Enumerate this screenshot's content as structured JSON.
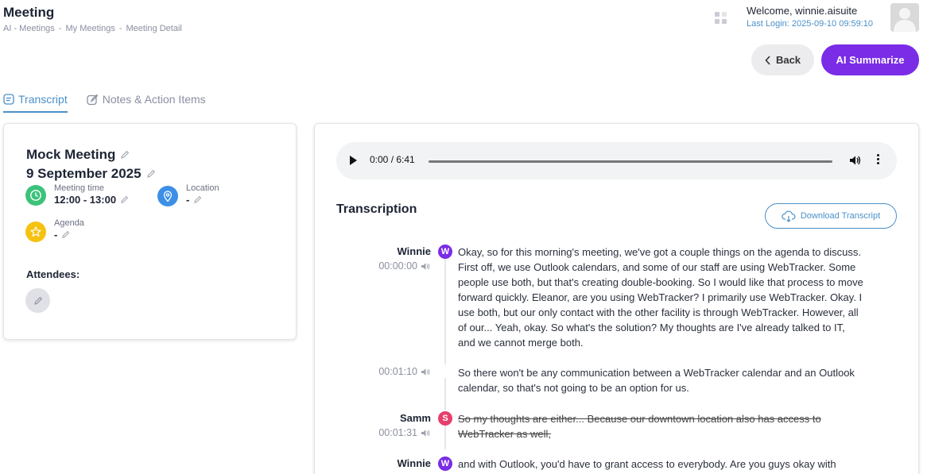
{
  "header": {
    "title": "Meeting",
    "breadcrumb": [
      "AI - Meetings",
      "My Meetings",
      "Meeting Detail"
    ],
    "breadcrumb_sep": "-",
    "welcome": "Welcome, winnie.aisuite",
    "last_login": "Last Login: 2025-09-10 09:59:10"
  },
  "actions": {
    "back_label": "Back",
    "ai_summarize_label": "AI Summarize"
  },
  "tabs": [
    {
      "label": "Transcript",
      "active": true
    },
    {
      "label": "Notes & Action Items",
      "active": false
    }
  ],
  "meeting": {
    "name": "Mock Meeting",
    "date": "9 September 2025",
    "time_label": "Meeting time",
    "time_value": "12:00 - 13:00",
    "location_label": "Location",
    "location_value": "-",
    "agenda_label": "Agenda",
    "agenda_value": "-",
    "attendees_label": "Attendees:"
  },
  "audio": {
    "time": "0:00 / 6:41"
  },
  "transcription": {
    "title": "Transcription",
    "download_label": "Download Transcript",
    "entries": [
      {
        "speaker": "Winnie",
        "initial": "W",
        "color": "#7a2ce6",
        "timestamp": "00:00:00",
        "struck": false,
        "text": "Okay, so for this morning's meeting, we've got a couple things on the agenda to discuss. First off, we use Outlook calendars, and some of our staff are using WebTracker. Some people use both, but that's creating double-booking. So I would like that process to move forward quickly. Eleanor, are you using WebTracker? I primarily use WebTracker. Okay. I use both, but our only contact with the other facility is through WebTracker. However, all of our... Yeah, okay. So what's the solution? My thoughts are I've already talked to IT, and we cannot merge both."
      },
      {
        "speaker": "",
        "initial": "",
        "color": "",
        "timestamp": "00:01:10",
        "struck": false,
        "text": "So there won't be any communication between a WebTracker calendar and an Outlook calendar, so that's not going to be an option for us."
      },
      {
        "speaker": "Samm",
        "initial": "S",
        "color": "#e83e6c",
        "timestamp": "00:01:31",
        "struck": true,
        "text": "So my thoughts are either... Because our downtown location also has access to WebTracker as well,"
      },
      {
        "speaker": "Winnie",
        "initial": "W",
        "color": "#7a2ce6",
        "timestamp": "",
        "struck": false,
        "text": "and with Outlook, you'd have to grant access to everybody. Are you guys okay with"
      }
    ]
  }
}
